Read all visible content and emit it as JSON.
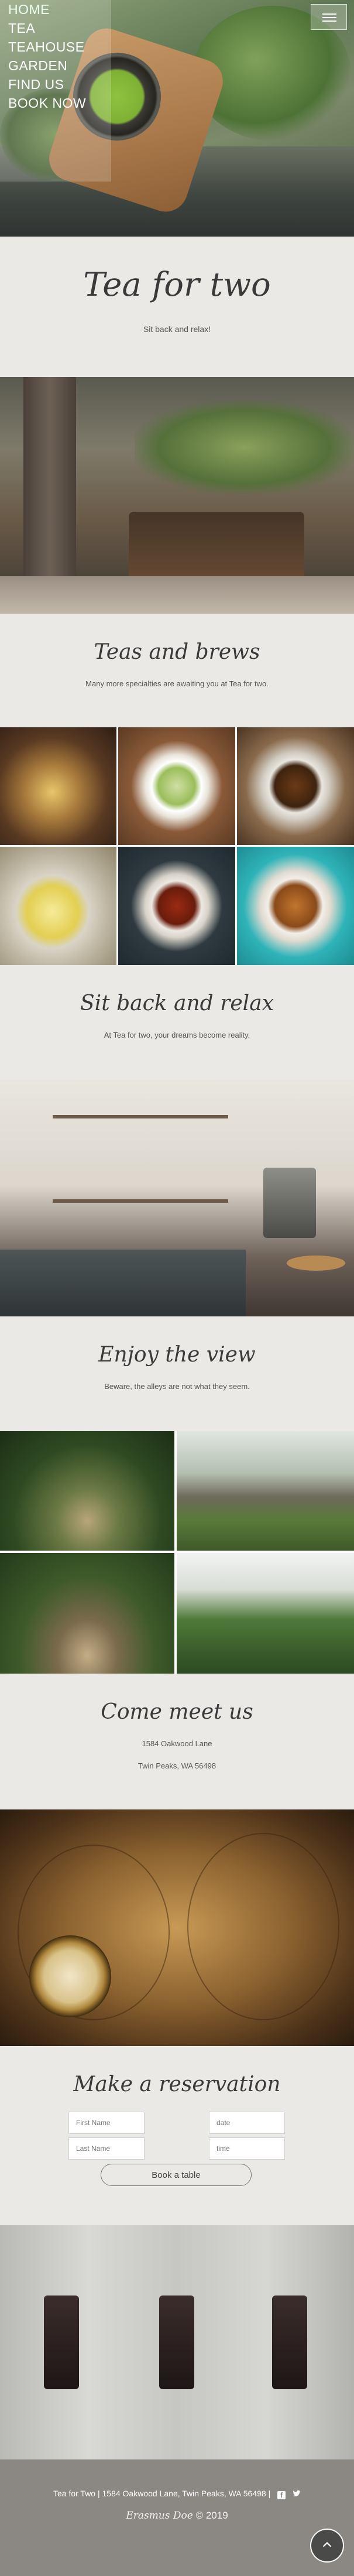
{
  "nav": {
    "items": [
      "HOME",
      "TEA",
      "TEAHOUSE",
      "GARDEN",
      "FIND US",
      "BOOK NOW"
    ]
  },
  "intro": {
    "title": "Tea for two",
    "subtitle": "Sit back and relax!"
  },
  "teas": {
    "title": "Teas and brews",
    "subtitle": "Many more specialties are awaiting you at Tea for two."
  },
  "relax": {
    "title": "Sit back and relax",
    "subtitle": "At Tea for two, your dreams become reality."
  },
  "view": {
    "title": "Enjoy the view",
    "subtitle": "Beware, the alleys are not what they seem."
  },
  "contact": {
    "title": "Come meet us",
    "street": "1584 Oakwood Lane",
    "city": "Twin Peaks, WA 56498"
  },
  "reservation": {
    "title": "Make a reservation",
    "first_name_placeholder": "First Name",
    "last_name_placeholder": "Last Name",
    "date_placeholder": "date",
    "time_placeholder": "time",
    "submit_label": "Book a table"
  },
  "footer": {
    "text": "Tea for Two  |  1584 Oakwood Lane, Twin Peaks, WA 56498  |",
    "author": "Erasmus Doe",
    "year": "© 2019"
  },
  "icons": {
    "menu": "hamburger-icon",
    "facebook": "facebook-icon",
    "twitter": "twitter-icon",
    "scroll_top": "chevron-up-icon"
  },
  "colors": {
    "band_background": "#ebe9e6",
    "footer_background": "#8b8782",
    "text": "#3a3a3a"
  }
}
